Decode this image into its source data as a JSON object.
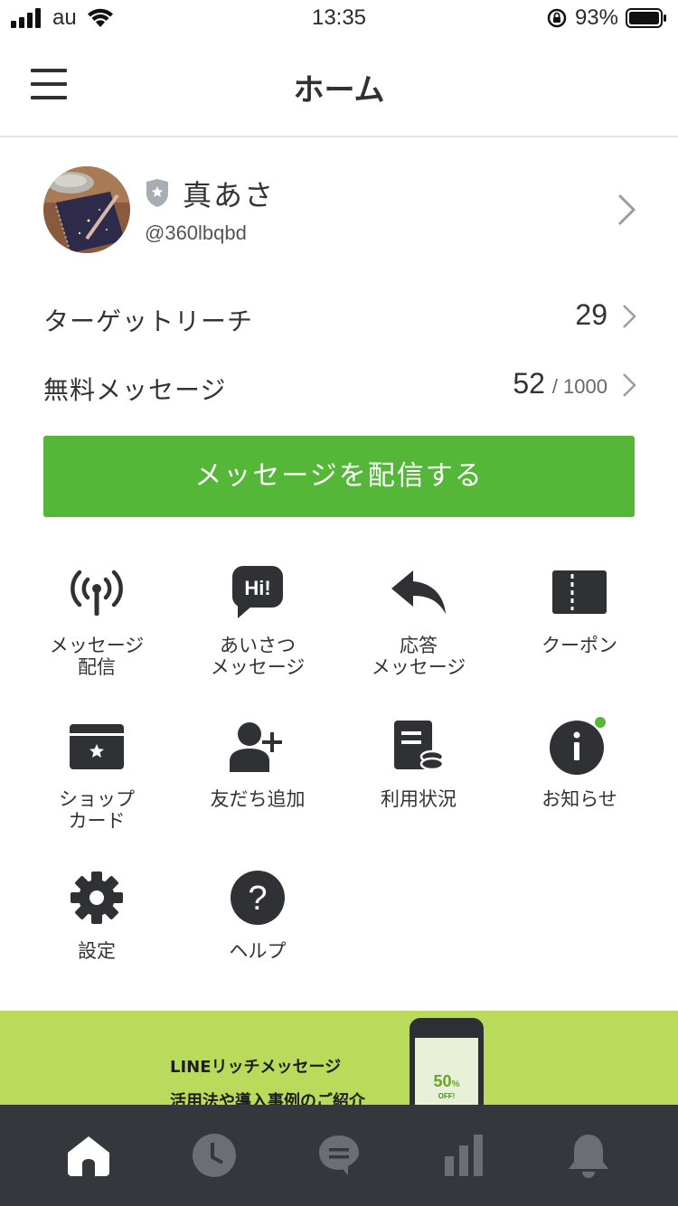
{
  "status_bar": {
    "carrier": "au",
    "time": "13:35",
    "battery_percent": "93%"
  },
  "header": {
    "title": "ホーム"
  },
  "profile": {
    "name": "真あさ",
    "account_id": "@360lbqbd"
  },
  "stats": {
    "target_reach": {
      "label": "ターゲットリーチ",
      "value": "29"
    },
    "free_messages": {
      "label": "無料メッセージ",
      "value": "52",
      "separator": "/",
      "total": "1000"
    }
  },
  "cta": {
    "label": "メッセージを配信する"
  },
  "menu": {
    "items": [
      {
        "label": "メッセージ\n配信",
        "icon": "broadcast-icon"
      },
      {
        "label": "あいさつ\nメッセージ",
        "icon": "hi-bubble-icon"
      },
      {
        "label": "応答\nメッセージ",
        "icon": "reply-icon"
      },
      {
        "label": "クーポン",
        "icon": "coupon-icon"
      },
      {
        "label": "ショップ\nカード",
        "icon": "shop-card-icon"
      },
      {
        "label": "友だち追加",
        "icon": "add-friend-icon"
      },
      {
        "label": "利用状況",
        "icon": "usage-icon"
      },
      {
        "label": "お知らせ",
        "icon": "info-icon"
      },
      {
        "label": "設定",
        "icon": "gear-icon"
      },
      {
        "label": "ヘルプ",
        "icon": "help-icon"
      }
    ]
  },
  "banner": {
    "line1": "LINEリッチメッセージ",
    "line2": "活用法や導入事例のご紹介",
    "sale_value": "50",
    "sale_unit": "%",
    "sale_off": "OFF!"
  },
  "tab_bar": {
    "items": [
      "home-icon",
      "clock-icon",
      "chat-icon",
      "stats-icon",
      "bell-icon"
    ],
    "active": "home-icon"
  },
  "colors": {
    "accent_green": "#55b737",
    "dark_icon": "#2f3134",
    "tab_bar_bg": "#34373b",
    "banner_bg": "#bada5c",
    "notification_dot": "#55b737"
  }
}
